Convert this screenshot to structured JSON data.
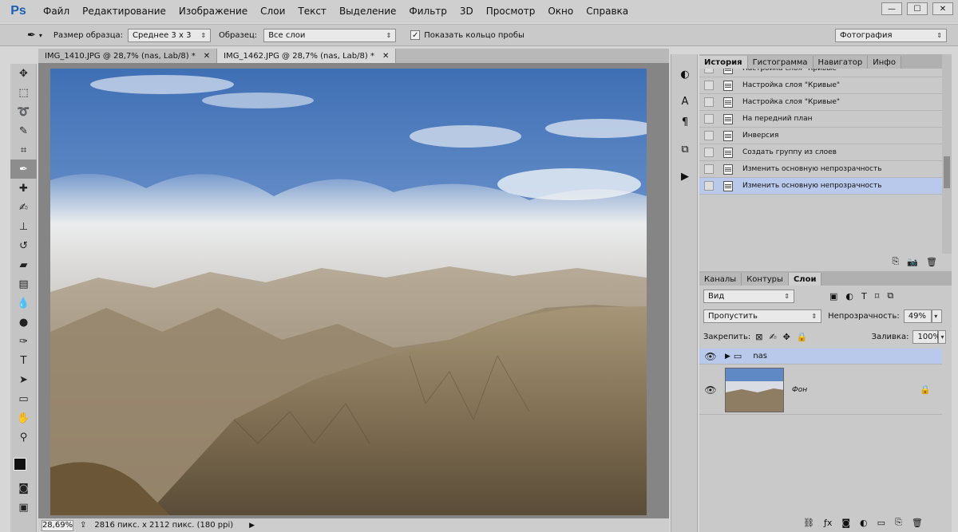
{
  "app": {
    "logo": "Ps"
  },
  "menu": [
    "Файл",
    "Редактирование",
    "Изображение",
    "Слои",
    "Текст",
    "Выделение",
    "Фильтр",
    "3D",
    "Просмотр",
    "Окно",
    "Справка"
  ],
  "window_controls": {
    "minimize": "—",
    "maximize": "☐",
    "close": "✕"
  },
  "options": {
    "sample_size_label": "Размер образца:",
    "sample_size_value": "Среднее 3 x 3",
    "sample_label": "Образец:",
    "sample_value": "Все слои",
    "show_ring_label": "Показать кольцо пробы",
    "show_ring_checked": "✓",
    "workspace_value": "Фотография"
  },
  "tabs": [
    {
      "label": "IMG_1410.JPG @ 28,7% (nas, Lab/8) *",
      "close": "✕"
    },
    {
      "label": "IMG_1462.JPG @ 28,7% (nas, Lab/8) *",
      "close": "✕"
    }
  ],
  "status": {
    "zoom": "28,69%",
    "doc_info": "2816 пикс. x 2112 пикс. (180 ppi)"
  },
  "history": {
    "tabs": [
      "История",
      "Гистограмма",
      "Навигатор",
      "Инфо"
    ],
    "items": [
      "Настройка слоя \"Кривые\"",
      "Настройка слоя \"Кривые\"",
      "Настройка слоя \"Кривые\"",
      "На передний план",
      "Инверсия",
      "Создать группу из слоев",
      "Изменить основную непрозрачность",
      "Изменить основную непрозрачность"
    ],
    "selected_index": 7
  },
  "layers": {
    "tabs": [
      "Каналы",
      "Контуры",
      "Слои"
    ],
    "filter_value": "Вид",
    "blend_mode": "Пропустить",
    "opacity_label": "Непрозрачность:",
    "opacity_value": "49%",
    "lock_label": "Закрепить:",
    "fill_label": "Заливка:",
    "fill_value": "100%",
    "items": [
      {
        "name": "nas",
        "type": "group"
      },
      {
        "name": "Фон",
        "type": "background"
      }
    ]
  },
  "colors": {
    "accent_selected": "#b9c9ec",
    "canvas_bg": "#858585"
  }
}
